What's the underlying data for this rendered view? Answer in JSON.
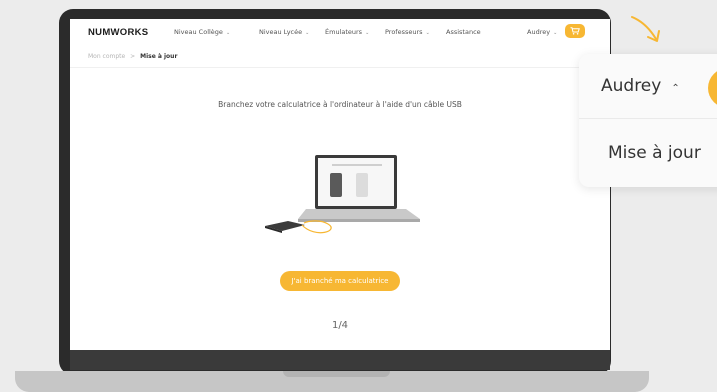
{
  "brand": {
    "logo": "NUMWORKS",
    "accent_color": "#f7b733"
  },
  "nav": {
    "items": [
      {
        "label": "Niveau Collège",
        "dropdown": true
      },
      {
        "label": "Niveau Lycée",
        "dropdown": true
      },
      {
        "label": "Émulateurs",
        "dropdown": true
      },
      {
        "label": "Professeurs",
        "dropdown": true
      },
      {
        "label": "Assistance",
        "dropdown": false
      }
    ],
    "user": "Audrey",
    "cart_icon": "cart-icon"
  },
  "breadcrumb": {
    "parent": "Mon compte",
    "separator": ">",
    "current": "Mise à jour"
  },
  "main": {
    "instruction": "Branchez votre calculatrice à l'ordinateur à l'aide d'un câble USB",
    "button_label": "J'ai branché ma calculatrice",
    "step": "1/4"
  },
  "popup": {
    "user": "Audrey",
    "item": "Mise à jour"
  }
}
